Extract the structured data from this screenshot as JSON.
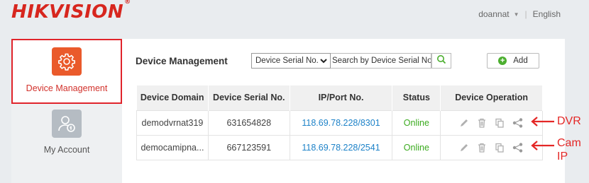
{
  "brand": {
    "logo_text": "HIKVISION",
    "reg_mark": "®"
  },
  "topbar": {
    "user": "doannat",
    "language": "English"
  },
  "sidebar": {
    "items": [
      {
        "label": "Device Management",
        "icon": "gear-icon",
        "active": true
      },
      {
        "label": "My Account",
        "icon": "user-icon",
        "active": false
      }
    ]
  },
  "main": {
    "title": "Device Management",
    "search": {
      "field_selected": "Device Serial No.",
      "placeholder": "Search by Device Serial No."
    },
    "add_label": "Add",
    "table": {
      "columns": [
        "Device Domain",
        "Device Serial No.",
        "IP/Port No.",
        "Status",
        "Device Operation"
      ],
      "rows": [
        {
          "domain": "demodvrnat319",
          "serial": "631654828",
          "ip": "118.69.78.228/8301",
          "status": "Online"
        },
        {
          "domain": "democamipna...",
          "serial": "667123591",
          "ip": "118.69.78.228/2541",
          "status": "Online"
        }
      ]
    }
  },
  "annotations": {
    "dvr": "DVR",
    "cam_line1": "Cam",
    "cam_line2": "IP"
  },
  "colors": {
    "brand_red": "#d7261e",
    "highlight_red": "#e0242b",
    "tile_orange": "#ea5a2b",
    "online_green": "#3bab1f",
    "link_blue": "#1d82c8"
  }
}
